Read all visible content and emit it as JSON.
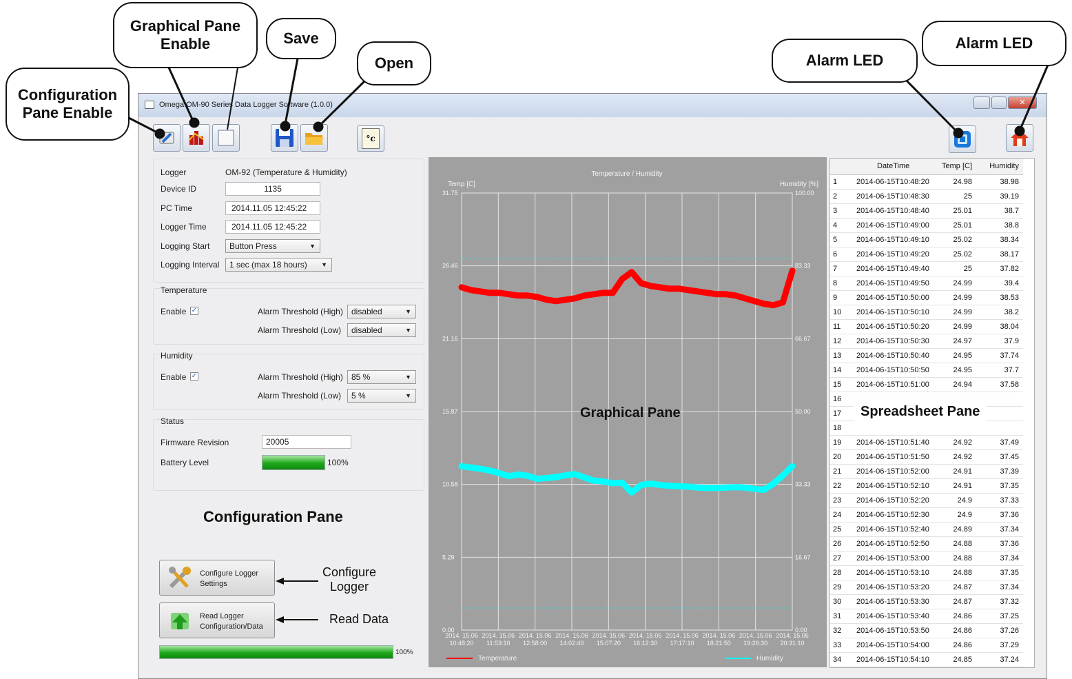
{
  "window": {
    "title": "Omega OM-90 Series Data Logger Software (1.0.0)"
  },
  "callouts": {
    "config_enable": "Configuration Pane Enable",
    "graph_enable": "Graphical Pane Enable",
    "save": "Save",
    "open": "Open",
    "alarm_led_1": "Alarm LED",
    "alarm_led_2": "Alarm LED"
  },
  "toolbar": {
    "unit_label": "°c"
  },
  "config": {
    "logger_label": "Logger",
    "logger_value": "OM-92 (Temperature & Humidity)",
    "device_id_label": "Device ID",
    "device_id_value": "1135",
    "pc_time_label": "PC Time",
    "pc_time_value": "2014.11.05 12:45:22",
    "logger_time_label": "Logger Time",
    "logger_time_value": "2014.11.05 12:45:22",
    "logging_start_label": "Logging Start",
    "logging_start_value": "Button Press",
    "logging_interval_label": "Logging Interval",
    "logging_interval_value": "1 sec (max 18 hours)",
    "temperature_title": "Temperature",
    "temp_enable_label": "Enable",
    "temp_high_label": "Alarm Threshold (High)",
    "temp_high_value": "disabled",
    "temp_low_label": "Alarm Threshold (Low)",
    "temp_low_value": "disabled",
    "humidity_title": "Humidity",
    "hum_enable_label": "Enable",
    "hum_high_label": "Alarm Threshold (High)",
    "hum_high_value": "85 %",
    "hum_low_label": "Alarm Threshold (Low)",
    "hum_low_value": "5 %",
    "status_title": "Status",
    "firmware_label": "Firmware Revision",
    "firmware_value": "20005",
    "battery_label": "Battery Level",
    "battery_percent": 100,
    "battery_text": "100%",
    "pane_label": "Configuration Pane",
    "configure_btn_line1": "Configure Logger",
    "configure_btn_line2": "Settings",
    "read_btn_line1": "Read Logger",
    "read_btn_line2": "Configuration/Data",
    "configure_annotation_1": "Configure",
    "configure_annotation_2": "Logger",
    "read_annotation": "Read Data",
    "progress_percent": 100,
    "progress_text": "100%"
  },
  "chart_data": {
    "type": "line",
    "title": "Temperature / Humidity",
    "ylabel": "Temp [C]",
    "y2label": "Humidity [%]",
    "ylim": [
      0,
      31.75
    ],
    "y2lim": [
      0,
      100
    ],
    "y_ticks": [
      "31.75",
      "26.46",
      "21.16",
      "15.87",
      "10.58",
      "5.29",
      "0.00"
    ],
    "y2_ticks": [
      "100.00",
      "83.33",
      "66.67",
      "50.00",
      "33.33",
      "16.67",
      "0.00"
    ],
    "x_ticks": [
      {
        "date": "2014. 15.06",
        "time": "10:48:20"
      },
      {
        "date": "2014. 15.06",
        "time": "11:53:10"
      },
      {
        "date": "2014. 15.06",
        "time": "12:58:00"
      },
      {
        "date": "2014. 15.06",
        "time": "14:02:40"
      },
      {
        "date": "2014. 15.06",
        "time": "15:07:20"
      },
      {
        "date": "2014. 15.06",
        "time": "16:12:30"
      },
      {
        "date": "2014. 15.06",
        "time": "17:17:10"
      },
      {
        "date": "2014. 15.06",
        "time": "18:21:50"
      },
      {
        "date": "2014. 15.06",
        "time": "19:26:30"
      },
      {
        "date": "2014. 15.06",
        "time": "20:31:10"
      }
    ],
    "grid": true,
    "legend": "bottom",
    "temp_high_line": 27.0,
    "temp_low_line": 1.6,
    "series": [
      {
        "name": "Temperature",
        "color": "#ff0000",
        "axis": "left",
        "values": [
          24.9,
          24.7,
          24.6,
          24.5,
          24.5,
          24.4,
          24.3,
          24.3,
          24.2,
          24.0,
          23.9,
          24.0,
          24.1,
          24.3,
          24.4,
          24.5,
          24.5,
          25.5,
          26.0,
          25.2,
          25.0,
          24.9,
          24.8,
          24.8,
          24.7,
          24.6,
          24.5,
          24.4,
          24.4,
          24.3,
          24.1,
          23.9,
          23.7,
          23.6,
          23.8,
          26.1
        ]
      },
      {
        "name": "Humidity",
        "color": "#00ffff",
        "axis": "right",
        "values": [
          37.5,
          37.2,
          36.9,
          36.5,
          35.9,
          35.2,
          35.6,
          35.3,
          34.6,
          34.8,
          35.0,
          35.4,
          35.7,
          34.9,
          34.2,
          34.0,
          33.6,
          33.7,
          31.5,
          33.2,
          33.5,
          33.2,
          33.0,
          32.9,
          32.8,
          32.6,
          32.5,
          32.5,
          32.6,
          32.7,
          32.6,
          32.3,
          32.1,
          33.5,
          35.4,
          37.5
        ]
      }
    ]
  },
  "graph_pane_label": "Graphical Pane",
  "sheet": {
    "headers": [
      "",
      "DateTime",
      "Temp [C]",
      "Humidity"
    ],
    "pane_label": "Spreadsheet Pane",
    "rows": [
      [
        "1",
        "2014-06-15T10:48:20",
        "24.98",
        "38.98"
      ],
      [
        "2",
        "2014-06-15T10:48:30",
        "25",
        "39.19"
      ],
      [
        "3",
        "2014-06-15T10:48:40",
        "25.01",
        "38.7"
      ],
      [
        "4",
        "2014-06-15T10:49:00",
        "25.01",
        "38.8"
      ],
      [
        "5",
        "2014-06-15T10:49:10",
        "25.02",
        "38.34"
      ],
      [
        "6",
        "2014-06-15T10:49:20",
        "25.02",
        "38.17"
      ],
      [
        "7",
        "2014-06-15T10:49:40",
        "25",
        "37.82"
      ],
      [
        "8",
        "2014-06-15T10:49:50",
        "24.99",
        "39.4"
      ],
      [
        "9",
        "2014-06-15T10:50:00",
        "24.99",
        "38.53"
      ],
      [
        "10",
        "2014-06-15T10:50:10",
        "24.99",
        "38.2"
      ],
      [
        "11",
        "2014-06-15T10:50:20",
        "24.99",
        "38.04"
      ],
      [
        "12",
        "2014-06-15T10:50:30",
        "24.97",
        "37.9"
      ],
      [
        "13",
        "2014-06-15T10:50:40",
        "24.95",
        "37.74"
      ],
      [
        "14",
        "2014-06-15T10:50:50",
        "24.95",
        "37.7"
      ],
      [
        "15",
        "2014-06-15T10:51:00",
        "24.94",
        "37.58"
      ],
      [
        "16",
        "",
        "",
        ""
      ],
      [
        "17",
        "",
        "",
        ""
      ],
      [
        "18",
        "",
        "",
        ""
      ],
      [
        "19",
        "2014-06-15T10:51:40",
        "24.92",
        "37.49"
      ],
      [
        "20",
        "2014-06-15T10:51:50",
        "24.92",
        "37.45"
      ],
      [
        "21",
        "2014-06-15T10:52:00",
        "24.91",
        "37.39"
      ],
      [
        "22",
        "2014-06-15T10:52:10",
        "24.91",
        "37.35"
      ],
      [
        "23",
        "2014-06-15T10:52:20",
        "24.9",
        "37.33"
      ],
      [
        "24",
        "2014-06-15T10:52:30",
        "24.9",
        "37.36"
      ],
      [
        "25",
        "2014-06-15T10:52:40",
        "24.89",
        "37.34"
      ],
      [
        "26",
        "2014-06-15T10:52:50",
        "24.88",
        "37.36"
      ],
      [
        "27",
        "2014-06-15T10:53:00",
        "24.88",
        "37.34"
      ],
      [
        "28",
        "2014-06-15T10:53:10",
        "24.88",
        "37.35"
      ],
      [
        "29",
        "2014-06-15T10:53:20",
        "24.87",
        "37.34"
      ],
      [
        "30",
        "2014-06-15T10:53:30",
        "24.87",
        "37.32"
      ],
      [
        "31",
        "2014-06-15T10:53:40",
        "24.86",
        "37.25"
      ],
      [
        "32",
        "2014-06-15T10:53:50",
        "24.86",
        "37.26"
      ],
      [
        "33",
        "2014-06-15T10:54:00",
        "24.86",
        "37.29"
      ],
      [
        "34",
        "2014-06-15T10:54:10",
        "24.85",
        "37.24"
      ]
    ]
  },
  "colors": {
    "temperature": "#ff0000",
    "humidity": "#00ffff",
    "chart_bg": "#a0a0a0",
    "progress": "#1fa81c"
  }
}
